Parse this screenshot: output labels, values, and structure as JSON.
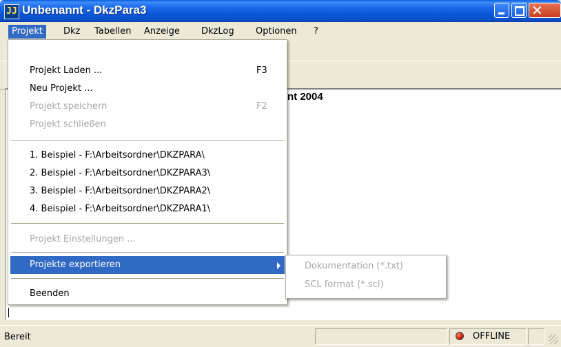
{
  "window": {
    "icon_text": "JJ",
    "title": "Unbenannt - DkzPara3"
  },
  "menubar": [
    {
      "label": "Projekt"
    },
    {
      "label": "Dkz"
    },
    {
      "label": "Tabellen"
    },
    {
      "label": "Anzeige"
    },
    {
      "label": "DkzLog"
    },
    {
      "label": "Optionen"
    },
    {
      "label": "?"
    }
  ],
  "document": {
    "visible_text": "nt 2004"
  },
  "projekt_menu": {
    "items": [
      {
        "label": "Projekt Laden ...",
        "shortcut": "F3"
      },
      {
        "label": "Neu Projekt ...",
        "shortcut": ""
      },
      {
        "label": "Projekt speichern",
        "shortcut": "F2",
        "disabled": true
      },
      {
        "label": "Projekt schließen",
        "shortcut": "",
        "disabled": true
      }
    ],
    "recent": [
      "1. Beispiel - F:\\Arbeitsordner\\DKZPARA\\",
      "2. Beispiel - F:\\Arbeitsordner\\DKZPARA3\\",
      "3. Beispiel - F:\\Arbeitsordner\\DKZPARA2\\",
      "4. Beispiel - F:\\Arbeitsordner\\DKZPARA1\\"
    ],
    "settings": "Projekt Einstellungen ...",
    "export": "Projekte exportieren",
    "quit": "Beenden"
  },
  "export_submenu": [
    "Dokumentation (*.txt)",
    "SCL format (*.scl)"
  ],
  "statusbar": {
    "text": "Bereit",
    "connection": "OFFLINE",
    "led_color": "#d11a00"
  },
  "colors": {
    "highlight": "#316AC5",
    "disabled_text": "#A7A6AA",
    "face": "#ECE9D8"
  }
}
